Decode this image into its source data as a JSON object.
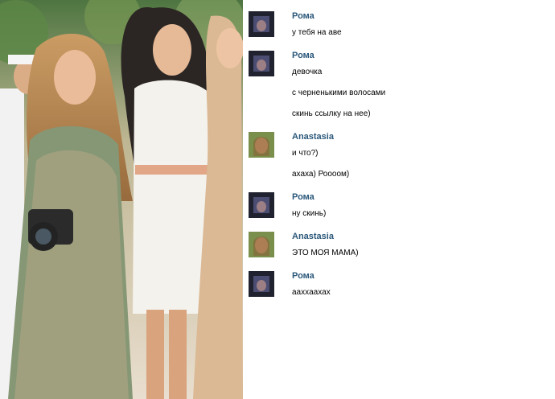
{
  "messages": [
    {
      "author": "Рома",
      "avatar": "roma-avatar",
      "lines": [
        "у тебя на аве"
      ]
    },
    {
      "author": "Рома",
      "avatar": "roma-avatar",
      "lines": [
        "девочка",
        "с черненькими волосами",
        "скинь ссылку на нее)"
      ]
    },
    {
      "author": "Anastasia",
      "avatar": "anastasia-avatar",
      "lines": [
        "и что?)",
        "ахаха) Роооом)"
      ]
    },
    {
      "author": "Рома",
      "avatar": "roma-avatar",
      "lines": [
        "ну скинь)"
      ]
    },
    {
      "author": "Anastasia",
      "avatar": "anastasia-avatar",
      "lines": [
        "ЭТО МОЯ МАМА)"
      ]
    },
    {
      "author": "Рома",
      "avatar": "roma-avatar",
      "lines": [
        "аахxaахах"
      ]
    }
  ],
  "colors": {
    "author": "#2b587a",
    "text": "#000000",
    "background": "#ffffff"
  }
}
